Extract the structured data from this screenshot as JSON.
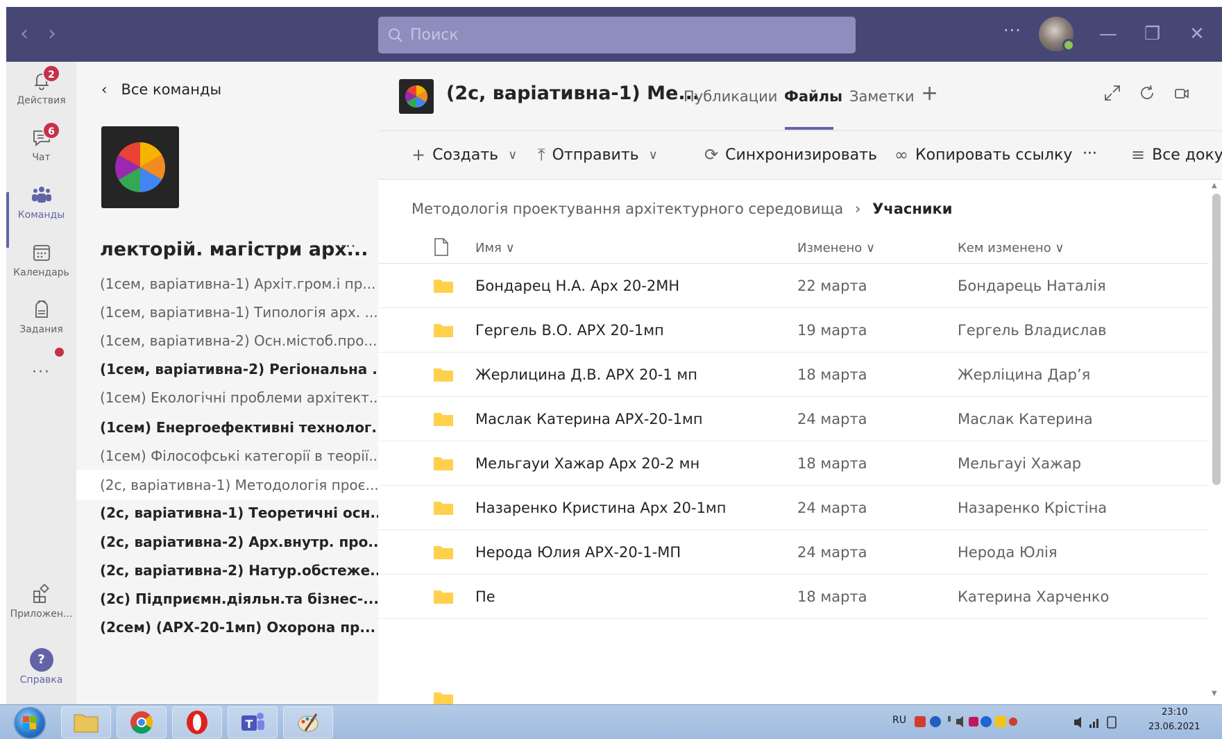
{
  "titlebar": {
    "search_placeholder": "Поиск",
    "more": "···"
  },
  "rail": {
    "activity": {
      "label": "Действия",
      "badge": "2"
    },
    "chat": {
      "label": "Чат",
      "badge": "6"
    },
    "teams": {
      "label": "Команды"
    },
    "calendar": {
      "label": "Календарь"
    },
    "assignments": {
      "label": "Задания"
    },
    "more": "···",
    "apps": {
      "label": "Приложен..."
    },
    "help": {
      "label": "Справка"
    }
  },
  "team_panel": {
    "back_label": "Все команды",
    "team_name": "лекторій. магістри арх...",
    "more": "···",
    "channels": [
      {
        "label": "(1сем, варіативна-1) Архіт.гром.і пр...",
        "bold": false
      },
      {
        "label": "(1сем, варіативна-1) Типологія арх. ...",
        "bold": false
      },
      {
        "label": "(1сем, варіативна-2) Осн.містоб.про...",
        "bold": false
      },
      {
        "label": "(1сем, варіативна-2) Регіональна ...",
        "bold": true
      },
      {
        "label": "(1сем) Екологічні проблеми архітект...",
        "bold": false
      },
      {
        "label": "(1сем) Енергоефективні технолог...",
        "bold": true
      },
      {
        "label": "(1сем) Філософські категорії в теорії...",
        "bold": false
      },
      {
        "label": "(2с, варіативна-1) Методологія проє...",
        "bold": false,
        "selected": true
      },
      {
        "label": "(2с, варіативна-1) Теоретичні осн...",
        "bold": true
      },
      {
        "label": "(2с, варіативна-2) Арх.внутр. про...",
        "bold": true
      },
      {
        "label": "(2с, варіативна-2) Натур.обстеже...",
        "bold": true
      },
      {
        "label": "(2с) Підприємн.діяльн.та бізнес-...",
        "bold": true
      },
      {
        "label": "(2сем) (АРХ-20-1мп) Охорона пр...",
        "bold": true
      }
    ]
  },
  "header": {
    "channel_title": "(2с, варіативна-1) Ме...",
    "tabs": [
      "Публикации",
      "Файлы",
      "Заметки"
    ],
    "active_tab": "Файлы"
  },
  "toolbar": {
    "create": "Создать",
    "upload": "Отправить",
    "sync": "Синхронизировать",
    "copy_link": "Копировать ссылку",
    "more": "···",
    "all_docs": "Все докум"
  },
  "breadcrumb": {
    "parent": "Методологія проектування архітектурного середовища",
    "current": "Учасники"
  },
  "file_list": {
    "columns": [
      "Имя",
      "Изменено",
      "Кем изменено"
    ],
    "rows": [
      {
        "name": "Бондарец Н.А. Арх 20-2МН",
        "modified": "22 марта",
        "modified_by": "Бондарець Наталія"
      },
      {
        "name": "Гергель В.О. АРХ 20-1мп",
        "modified": "19 марта",
        "modified_by": "Гергель Владислав"
      },
      {
        "name": "Жерлицина Д.В. АРХ 20-1 мп",
        "modified": "18 марта",
        "modified_by": "Жерліцина Дар’я"
      },
      {
        "name": "Маслак Катерина АРХ-20-1мп",
        "modified": "24 марта",
        "modified_by": "Маслак Катерина"
      },
      {
        "name": "Мельгауи Хажар Арх 20-2 мн",
        "modified": "18 марта",
        "modified_by": "Мельгауі Хажар"
      },
      {
        "name": "Назаренко Кристина Арх 20-1мп",
        "modified": "24 марта",
        "modified_by": "Назаренко Крістіна"
      },
      {
        "name": "Нерода Юлия АРХ-20-1-МП",
        "modified": "24 марта",
        "modified_by": "Нерода Юлія"
      },
      {
        "name": "Пе",
        "modified": "18 марта",
        "modified_by": "Катерина Харченко"
      }
    ]
  },
  "taskbar": {
    "language": "RU",
    "time": "23:10",
    "date": "23.06.2021"
  },
  "colors": {
    "titlebar": "#464775",
    "accent": "#6264a7",
    "badge": "#c4314b",
    "folder": "#ffd04b"
  }
}
